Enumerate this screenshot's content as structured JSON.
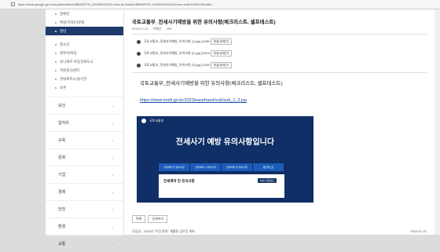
{
  "browser": {
    "url": "https://www.gongju.go.kr/prog/bbsArticle/BBSMSTR_000000001021/view.do?bbsId=BBSMSTR_000000001021&mno=sub01040200&nttId=..."
  },
  "sidebar": {
    "sub_items": [
      {
        "label": "장애인",
        "active": false
      },
      {
        "label": "여성/가족/다문화",
        "active": false
      },
      {
        "label": "청년",
        "active": true
      },
      {
        "label": "청소년",
        "active": false
      },
      {
        "label": "영유아/아동",
        "active": false
      },
      {
        "label": "유니세프 아동친화도시",
        "active": false
      },
      {
        "label": "자원봉사센터",
        "active": false
      },
      {
        "label": "관내복지시설/기관",
        "active": false
      },
      {
        "label": "보훈",
        "active": false
      }
    ],
    "main_items": [
      "보건",
      "일자리",
      "교육",
      "문화",
      "기업",
      "경제",
      "안전",
      "환경",
      "교통"
    ],
    "chevron": "chevron-down-icon"
  },
  "post": {
    "title": "국토교통부_전세사기예방을 위한 유의사항(체크리스트, 셀프테스트)",
    "date": "2023-07-14",
    "author": "이예진",
    "views": "299",
    "attachments": [
      {
        "name": "국토교통부_전세사기예방_유의사항 (1).jpg [1066.9 KB]",
        "button": "파일내려받기"
      },
      {
        "name": "국토교통부_전세사기예방_유의사항 (2).jpg [939.5 KB]",
        "button": "파일내려받기"
      },
      {
        "name": "국토교통부_전세사기예방_유의사항 (3).jpg [1335.9 KB]",
        "button": "파일내려받기"
      }
    ],
    "body": "국토교통부_전세사기예방을 위한 유의사항(체크리스트, 셀프테스트)",
    "link": "https://www.molit.go.kr/2022leasefraud/sub/sub_1_3.jsp"
  },
  "banner": {
    "org": "국토교통부",
    "headline": "전세사기 예방 유의사항입니다",
    "tabs": [
      "전세계약 전 유의사항",
      "전세계약 시 유의사항",
      "전세계약 후 유의사항",
      "셀프테스트"
    ],
    "card_title": "전세계약 전 유의사항",
    "card_button": "PDF 다운로드"
  },
  "actions": {
    "list": "목록",
    "print": "인쇄하기"
  },
  "next": {
    "label": "다음글 - 2023년 \"도민 환경\" 재활용 공모전 개최",
    "date": "2023-07-21"
  }
}
